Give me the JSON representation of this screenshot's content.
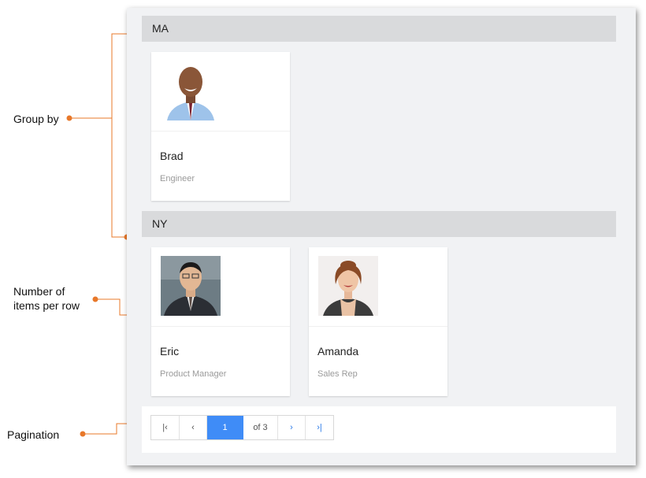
{
  "annotations": {
    "group_by": "Group by",
    "items_per_row": [
      "Number of",
      "items per row"
    ],
    "pagination": "Pagination"
  },
  "accent_color": "#e8782a",
  "groups": [
    {
      "header": "MA",
      "cards": [
        {
          "name": "Brad",
          "role": "Engineer"
        }
      ]
    },
    {
      "header": "NY",
      "cards": [
        {
          "name": "Eric",
          "role": "Product Manager"
        },
        {
          "name": "Amanda",
          "role": "Sales Rep"
        }
      ]
    }
  ],
  "pager": {
    "first_icon": "first-page-icon",
    "prev_icon": "prev-page-icon",
    "current": "1",
    "of_text": "of 3",
    "next_icon": "next-page-icon",
    "last_icon": "last-page-icon",
    "first_glyph": "|‹",
    "prev_glyph": "‹",
    "next_glyph": "›",
    "last_glyph": "›|"
  }
}
